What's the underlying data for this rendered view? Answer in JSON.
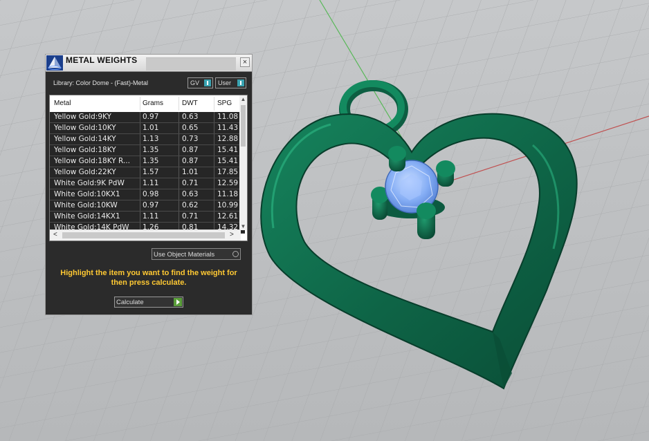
{
  "panel": {
    "title": "METAL WEIGHTS",
    "close_glyph": "×",
    "library_label": "Library: Color Dome - (Fast)-Metal",
    "toggles": {
      "gv": "GV",
      "user": "User"
    },
    "table": {
      "headers": [
        "Metal",
        "Grams",
        "DWT",
        "SPG"
      ],
      "rows": [
        {
          "metal": "Yellow Gold:9KY",
          "grams": "0.97",
          "dwt": "0.63",
          "spg": "11.08"
        },
        {
          "metal": "Yellow Gold:10KY",
          "grams": "1.01",
          "dwt": "0.65",
          "spg": "11.43"
        },
        {
          "metal": "Yellow Gold:14KY",
          "grams": "1.13",
          "dwt": "0.73",
          "spg": "12.88"
        },
        {
          "metal": "Yellow Gold:18KY",
          "grams": "1.35",
          "dwt": "0.87",
          "spg": "15.41"
        },
        {
          "metal": "Yellow Gold:18KY R...",
          "grams": "1.35",
          "dwt": "0.87",
          "spg": "15.41"
        },
        {
          "metal": "Yellow Gold:22KY",
          "grams": "1.57",
          "dwt": "1.01",
          "spg": "17.85"
        },
        {
          "metal": "White Gold:9K PdW",
          "grams": "1.11",
          "dwt": "0.71",
          "spg": "12.59"
        },
        {
          "metal": "White Gold:10KX1",
          "grams": "0.98",
          "dwt": "0.63",
          "spg": "11.18"
        },
        {
          "metal": "White Gold:10KW",
          "grams": "0.97",
          "dwt": "0.62",
          "spg": "10.99"
        },
        {
          "metal": "White Gold:14KX1",
          "grams": "1.11",
          "dwt": "0.71",
          "spg": "12.61"
        },
        {
          "metal": "White Gold:14K PdW",
          "grams": "1.26",
          "dwt": "0.81",
          "spg": "14.32"
        }
      ]
    },
    "use_object_materials": "Use Object Materials",
    "instruction": "Highlight the item you want to find the weight for then press calculate.",
    "calculate": "Calculate"
  },
  "icons": {
    "app": "pyramid-logo-icon",
    "close": "close-icon",
    "scroll_up": "▲",
    "scroll_down": "▼",
    "scroll_left": "<",
    "scroll_right": ">"
  },
  "colors": {
    "metal_green": "#0f6a4a",
    "gem_blue": "#7fa7f0",
    "instruction_yellow": "#ffc933",
    "toggle_teal": "#39a3b1"
  }
}
